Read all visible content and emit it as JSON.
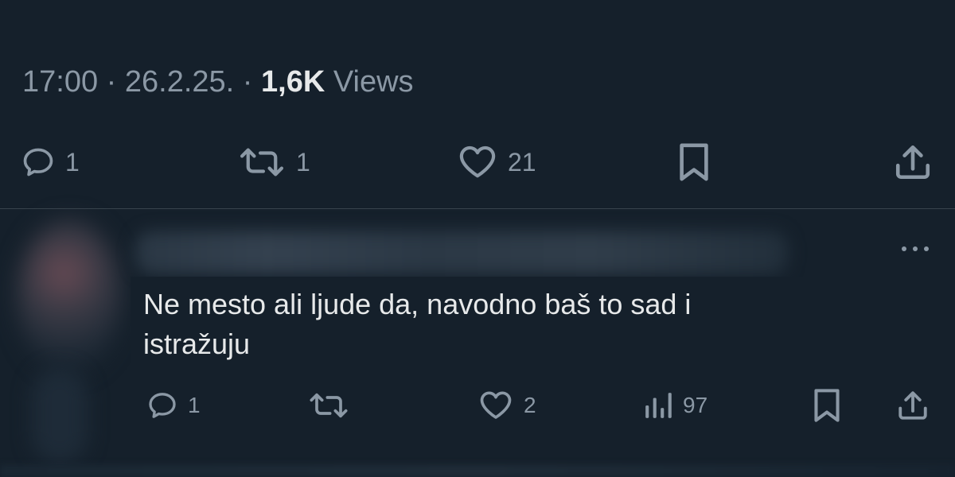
{
  "tweet": {
    "time": "17:00",
    "separator": "·",
    "date": "26.2.25.",
    "separator2": "·",
    "views_count": "1,6K",
    "views_label": "Views",
    "actions": {
      "reply_count": "1",
      "retweet_count": "1",
      "like_count": "21"
    }
  },
  "reply": {
    "more_icon": "more-horizontal-icon",
    "text_line1": "Ne mesto ali ljude da, navodno baš to sad i",
    "text_line2": "istražuju",
    "actions": {
      "reply_count": "1",
      "like_count": "2",
      "views_count": "97"
    }
  },
  "colors": {
    "background": "#15202b",
    "text": "#e7e9ea",
    "muted": "#8b98a5",
    "divider": "#38444d"
  }
}
